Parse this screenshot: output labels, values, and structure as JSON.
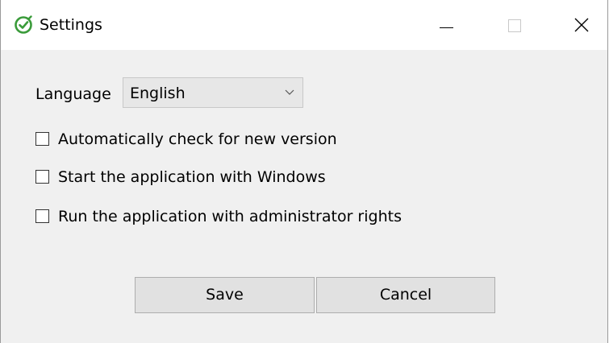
{
  "window": {
    "title": "Settings",
    "app_icon": "check-circle-icon",
    "controls": [
      "minimize-icon",
      "maximize-icon",
      "close-icon"
    ]
  },
  "language": {
    "label": "Language",
    "selected": "English"
  },
  "options": [
    {
      "label": "Automatically check for new version",
      "checked": false
    },
    {
      "label": "Start the application with Windows",
      "checked": false
    },
    {
      "label": "Run the application with administrator rights",
      "checked": false
    }
  ],
  "buttons": {
    "save": "Save",
    "cancel": "Cancel"
  },
  "colors": {
    "accent": "#3a9b3a",
    "dialog_background": "#f0f0f0",
    "button_background": "#e1e1e1"
  }
}
